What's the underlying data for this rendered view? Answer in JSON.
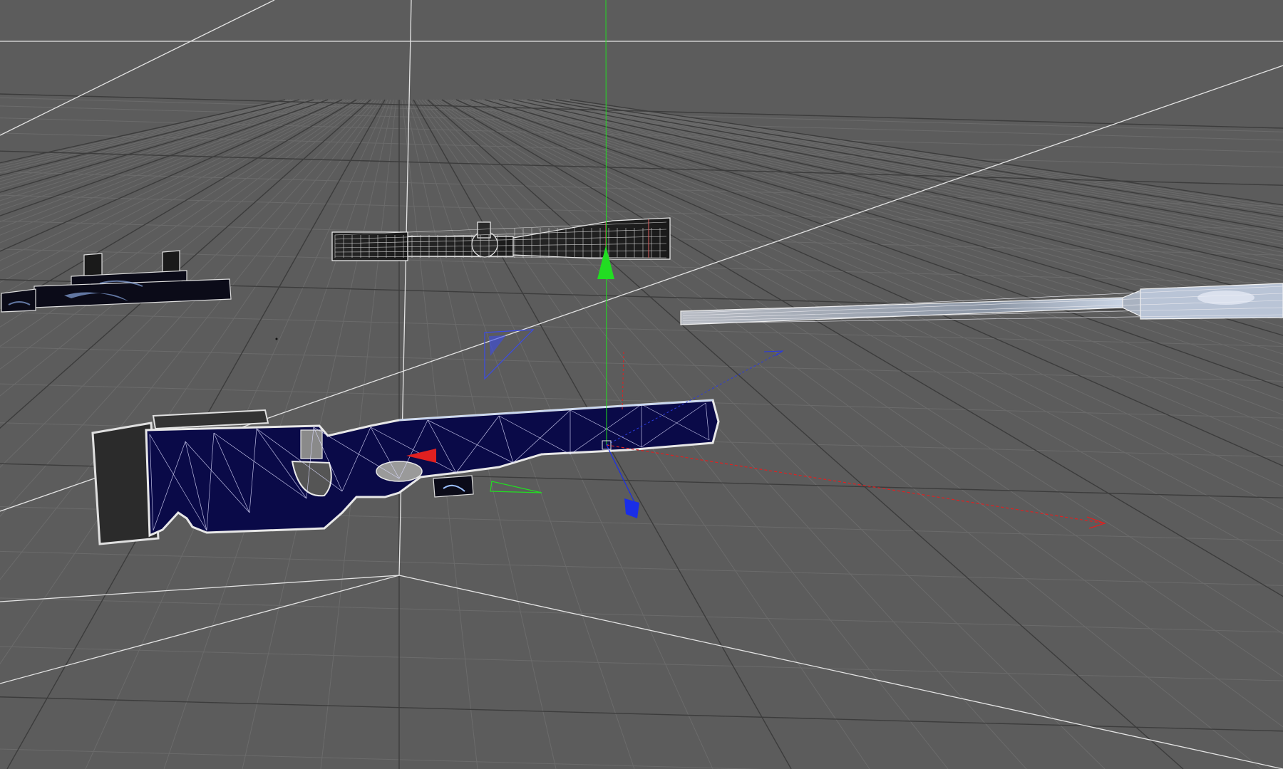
{
  "viewport": {
    "background_color": "#5c5c5c",
    "grid_color": "#6e6e6e",
    "grid_major_color": "#3f3f3f",
    "world_axis_color": "#e8e8e8"
  },
  "gizmo": {
    "x_axis_color": "#e02020",
    "y_axis_color": "#22dd22",
    "z_axis_color": "#1a2ee8"
  },
  "objects": [
    {
      "name_icon": "rifle-stock-object",
      "fill_color": "#0a0a40"
    },
    {
      "name_icon": "scope-object",
      "fill_color": "#2e2e2e"
    },
    {
      "name_icon": "barrel-object",
      "fill_color": "#9aa3b0"
    },
    {
      "name_icon": "rail-mount-object",
      "fill_color": "#0a0a14"
    }
  ]
}
